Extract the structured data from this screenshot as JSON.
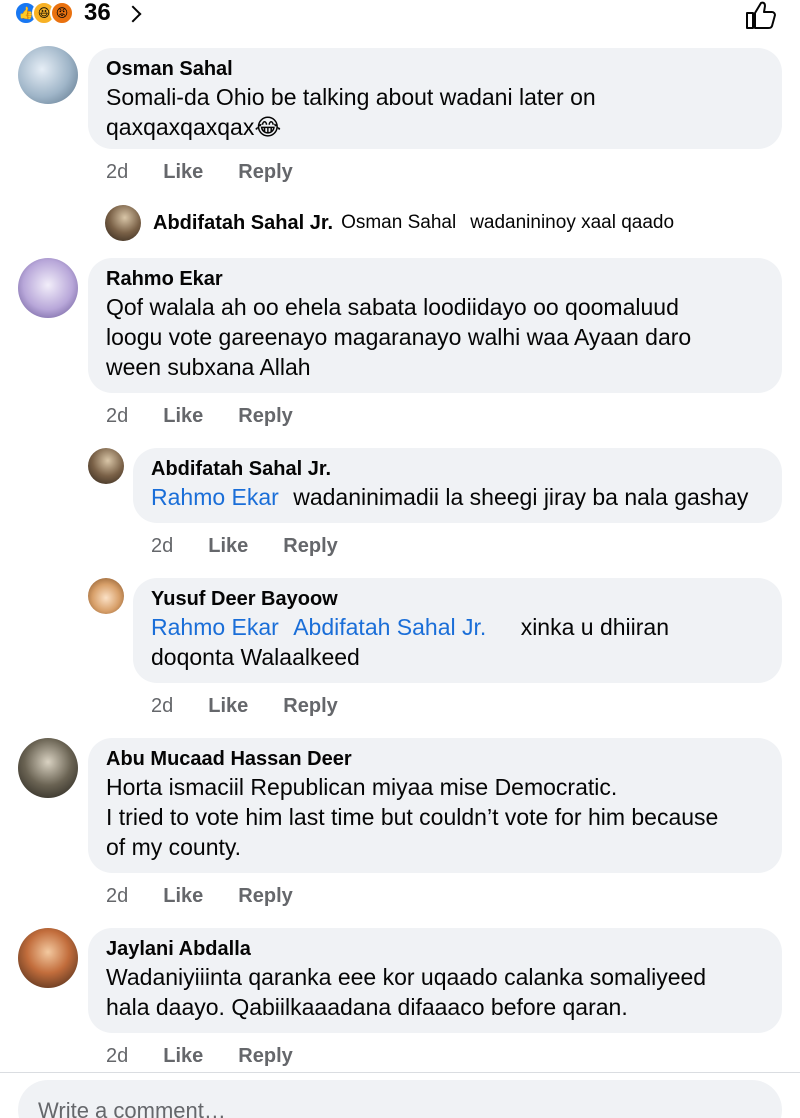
{
  "reactions": {
    "icons": [
      "like-icon",
      "haha-icon",
      "angry-icon"
    ],
    "count": "36"
  },
  "comments": [
    {
      "author": "Osman Sahal",
      "text_lines": [
        "Somali-da Ohio be talking about wadani later on",
        "qaxqaxqaxqax😂"
      ],
      "time": "2d",
      "like": "Like",
      "reply": "Reply",
      "inline_reply": {
        "author": "Abdifatah Sahal Jr.",
        "mention": "Osman Sahal",
        "text": "wadanininoy xaal qaado"
      }
    },
    {
      "author": "Rahmo Ekar",
      "text_lines": [
        "Qof walala ah oo ehela sabata loodiidayo oo qoomaluud",
        "loogu vote gareenayo magaranayo walhi waa Ayaan daro",
        "ween subxana Allah"
      ],
      "time": "2d",
      "like": "Like",
      "reply": "Reply",
      "replies": [
        {
          "author": "Abdifatah Sahal Jr.",
          "mentions": [
            "Rahmo Ekar"
          ],
          "text_line1": "wadaninimadii la sheegi jiray ba nala gashay",
          "time": "2d",
          "like": "Like",
          "reply": "Reply"
        },
        {
          "author": "Yusuf Deer Bayoow",
          "mentions": [
            "Rahmo Ekar",
            "Abdifatah Sahal Jr."
          ],
          "text_line1": "xinka  u dhiiran",
          "text_line2": "doqonta  Walaalkeed",
          "time": "2d",
          "like": "Like",
          "reply": "Reply"
        }
      ]
    },
    {
      "author": "Abu Mucaad Hassan Deer",
      "text_lines": [
        "Horta ismaciil Republican miyaa mise Democratic.",
        "I tried to vote him last time but couldn’t vote for him because",
        "of my county."
      ],
      "time": "2d",
      "like": "Like",
      "reply": "Reply"
    },
    {
      "author": "Jaylani Abdalla",
      "text_lines": [
        "Wadaniyiiinta qaranka eee kor uqaado calanka somaliyeed",
        "hala daayo. Qabiilkaaadana difaaaco before qaran."
      ],
      "time": "2d",
      "like": "Like",
      "reply": "Reply"
    }
  ],
  "composer": {
    "placeholder": "Write a comment…"
  }
}
